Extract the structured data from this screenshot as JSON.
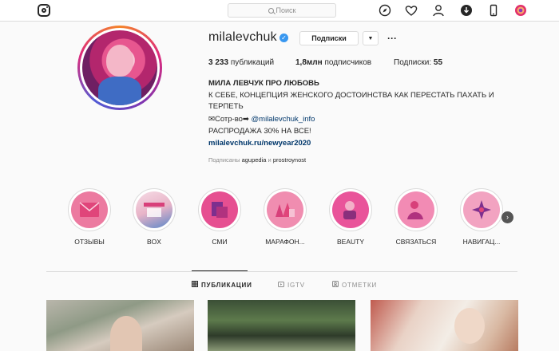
{
  "nav": {
    "search_placeholder": "Поиск",
    "icons": [
      "instagram-logo",
      "compass-icon",
      "heart-icon",
      "profile-icon",
      "download-icon",
      "phone-icon",
      "avatar"
    ]
  },
  "profile": {
    "username": "milalevchuk",
    "verified": true,
    "follow_label": "Подписки",
    "stats": {
      "posts_count": "3 233",
      "posts_label": "публикаций",
      "followers_count": "1,8млн",
      "followers_label": "подписчиков",
      "following_label": "Подписки:",
      "following_count": "55"
    },
    "bio": {
      "name": "МИЛА ЛЕВЧУК ПРО ЛЮБОВЬ",
      "line1": "К СЕБЕ, КОНЦЕПЦИЯ ЖЕНСКОГО ДОСТОИНСТВА КАК ПЕРЕСТАТЬ ПАХАТЬ И ТЕРПЕТЬ",
      "coop_prefix": "✉Сотр-во➡",
      "coop_link": "@milalevchuk_info",
      "line3": "РАСПРОДАЖА 30% НА ВСЕ!",
      "url": "milalevchuk.ru/newyear2020"
    },
    "followed_by": {
      "prefix": "Подписаны",
      "user1": "agupedia",
      "joiner": "и",
      "user2": "prostroynost"
    }
  },
  "highlights": [
    {
      "label": "ОТЗЫВЫ",
      "color": "#ec7aa0"
    },
    {
      "label": "BOX",
      "color": "#f0d2dc"
    },
    {
      "label": "СМИ",
      "color": "#e64f91"
    },
    {
      "label": "МАРАФОН...",
      "color": "#f08db0"
    },
    {
      "label": "BEAUTY",
      "color": "#e9549a"
    },
    {
      "label": "СВЯЗАТЬСЯ",
      "color": "#f28bb4"
    },
    {
      "label": "НАВИГАЦ...",
      "color": "#f2a3c1"
    }
  ],
  "tabs": [
    {
      "label": "ПУБЛИКАЦИИ",
      "active": true
    },
    {
      "label": "IGTV",
      "active": false
    },
    {
      "label": "ОТМЕТКИ",
      "active": false
    }
  ]
}
